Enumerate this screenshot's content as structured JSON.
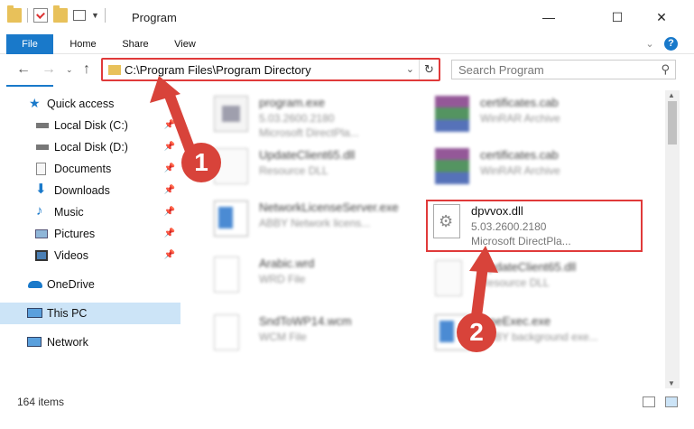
{
  "window": {
    "title": "Program",
    "minimize": "—",
    "maximize": "☐",
    "close": "✕"
  },
  "ribbon": {
    "tabs": [
      "File",
      "Home",
      "Share",
      "View"
    ],
    "collapse": "⌄",
    "help": "?"
  },
  "address": {
    "path": "C:\\Program Files\\Program Directory",
    "chevron": "⌄",
    "refresh": "↻"
  },
  "search": {
    "placeholder": "Search Program",
    "icon": "⚲"
  },
  "sidebar": {
    "items": [
      {
        "label": "Quick access",
        "icon": "star-icon",
        "pinned": false
      },
      {
        "label": "Local Disk (C:)",
        "icon": "drive-icon",
        "pinned": true
      },
      {
        "label": "Local Disk (D:)",
        "icon": "drive-icon",
        "pinned": true
      },
      {
        "label": "Documents",
        "icon": "documents-icon",
        "pinned": true
      },
      {
        "label": "Downloads",
        "icon": "download-icon",
        "pinned": true
      },
      {
        "label": "Music",
        "icon": "music-icon",
        "pinned": true
      },
      {
        "label": "Pictures",
        "icon": "pictures-icon",
        "pinned": true
      },
      {
        "label": "Videos",
        "icon": "videos-icon",
        "pinned": true
      },
      {
        "label": "OneDrive",
        "icon": "cloud-icon",
        "pinned": false
      },
      {
        "label": "This PC",
        "icon": "computer-icon",
        "pinned": false
      },
      {
        "label": "Network",
        "icon": "network-icon",
        "pinned": false
      }
    ],
    "pin_glyph": "📌"
  },
  "files": {
    "left": [
      {
        "name": "program.exe",
        "line1": "5.03.2600.2180",
        "line2": "Microsoft DirectPla...",
        "icon": "exe-icon"
      },
      {
        "name": "UpdateClient65.dll",
        "line1": "Resource DLL",
        "line2": "",
        "icon": "dll-icon"
      },
      {
        "name": "NetworkLicenseServer.exe",
        "line1": "ABBY Network licens...",
        "line2": "",
        "icon": "exe-window-icon"
      },
      {
        "name": "Arabic.wrd",
        "line1": "WRD File",
        "line2": "",
        "icon": "blank-file-icon"
      },
      {
        "name": "SndToWP14.wcm",
        "line1": "WCM File",
        "line2": "",
        "icon": "blank-file-icon"
      }
    ],
    "right": [
      {
        "name": "certificates.cab",
        "line1": "WinRAR Archive",
        "line2": "",
        "icon": "winrar-icon"
      },
      {
        "name": "certificates.cab",
        "line1": "WinRAR Archive",
        "line2": "",
        "icon": "winrar-icon"
      },
      {
        "name": "dpvvox.dll",
        "line1": "5.03.2600.2180",
        "line2": "Microsoft DirectPla...",
        "icon": "dll-gear-icon"
      },
      {
        "name": "UpdateClient65.dll",
        "line1": "Resource DLL",
        "line2": "",
        "icon": "dll-icon"
      },
      {
        "name": "OneExec.exe",
        "line1": "ABBY background exe...",
        "line2": "",
        "icon": "exe-window-icon"
      }
    ]
  },
  "status": {
    "item_count": "164 items"
  },
  "annotations": {
    "step1": "1",
    "step2": "2"
  },
  "colors": {
    "accent": "#1979ca",
    "highlight": "#e03a3a",
    "badge": "#d8433a",
    "selected": "#cce4f7"
  }
}
